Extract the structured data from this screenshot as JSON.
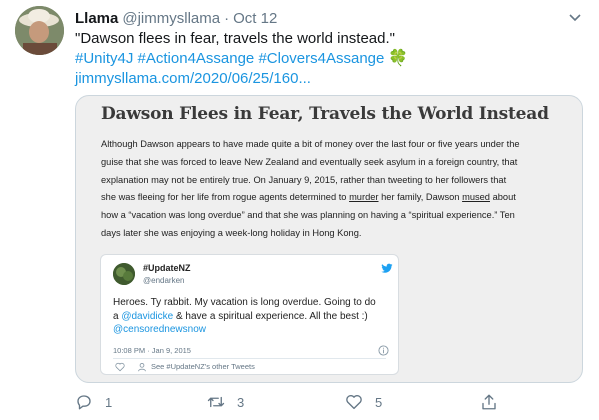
{
  "tweet": {
    "name": "Llama",
    "handle": "@jimmysllama",
    "separator": "·",
    "date": "Oct 12",
    "text_line1": "\"Dawson flees in fear, travels the world instead.\"",
    "hashtags": [
      "#Unity4J",
      "#Action4Assange",
      "#Clovers4Assange"
    ],
    "clover": "🍀",
    "link": "jimmysllama.com/2020/06/25/160..."
  },
  "article": {
    "title": "Dawson Flees in Fear, Travels the World Instead",
    "lines": [
      "Although Dawson appears to have made quite a bit of money over the last four or five years under the",
      "guise that she was forced to leave New Zealand and eventually seek asylum in a foreign country, that",
      "explanation may not be entirely true. On January 9, 2015, rather than tweeting to her followers that",
      "she was fleeing for her life from rogue agents determined to",
      "murder",
      "her family, Dawson",
      "mused",
      "about",
      "how a “vacation was long overdue” and that she was planning on having a “spiritual experience.” Ten",
      "days later she was enjoying a week-long holiday in Hong Kong."
    ]
  },
  "embed": {
    "name": "#UpdateNZ",
    "handle": "@endarken",
    "text_line1": "Heroes. Ty rabbit. My vacation is long overdue. Going to do",
    "text_line2_pre": "a ",
    "mention1": "@davidicke",
    "text_line2_post": " & have a spiritual experience. All the best :)",
    "mention2": "@censorednewsnow",
    "time": "10:08 PM · Jan 9, 2015",
    "other_tweets": "See #UpdateNZ's other Tweets"
  },
  "actions": {
    "reply_count": "1",
    "retweet_count": "3",
    "like_count": "5"
  },
  "colors": {
    "link": "#1b95e0",
    "muted": "#657786",
    "card_bg": "#efefef"
  },
  "icons": [
    "chevron-down-icon",
    "twitter-bird-icon",
    "info-icon",
    "heart-icon",
    "person-icon",
    "reply-icon",
    "retweet-icon",
    "like-icon",
    "share-icon"
  ]
}
